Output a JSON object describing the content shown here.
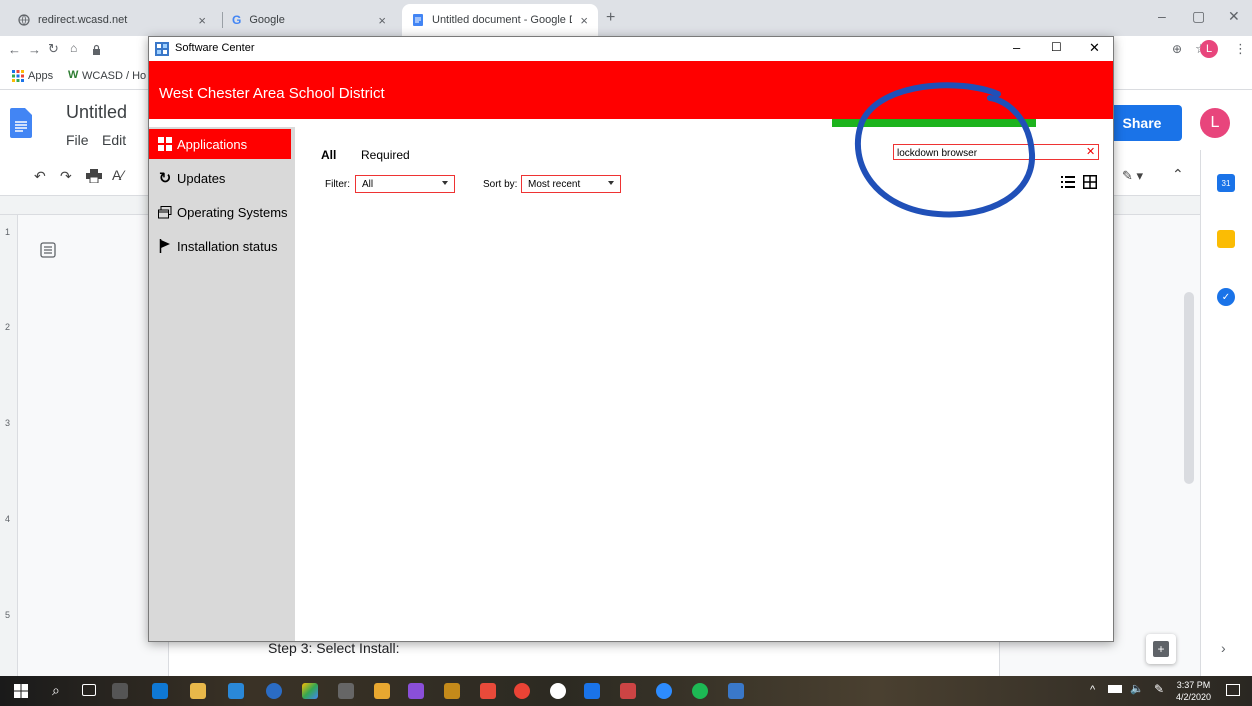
{
  "browser": {
    "tabs": [
      {
        "label": "redirect.wcasd.net",
        "close": "×"
      },
      {
        "label": "Google",
        "close": "×"
      },
      {
        "label": "Untitled document - Google Doc",
        "close": "×"
      }
    ],
    "new_tab": "+",
    "bookmarks": {
      "apps": "Apps",
      "wcasd": "WCASD / Ho"
    },
    "profile_initial": "L"
  },
  "docs": {
    "title": "Untitled",
    "menu_file": "File",
    "menu_edit": "Edit",
    "share_label": "Share",
    "avatar_initial": "L",
    "body_text": "Step 3: Select Install:",
    "ruler_numbers": [
      "1",
      "2",
      "3",
      "4",
      "5"
    ]
  },
  "software_center": {
    "window_title": "Software Center",
    "banner_title": "West Chester Area School District",
    "sidebar": [
      {
        "label": "Applications",
        "icon": "applications-icon",
        "active": true
      },
      {
        "label": "Updates",
        "icon": "refresh-icon",
        "active": false
      },
      {
        "label": "Operating Systems",
        "icon": "windows-stack-icon",
        "active": false
      },
      {
        "label": "Installation status",
        "icon": "flag-icon",
        "active": false
      }
    ],
    "tabs": {
      "all": "All",
      "required": "Required"
    },
    "filter_label": "Filter:",
    "filter_value": "All",
    "sort_label": "Sort by:",
    "sort_value": "Most recent",
    "search_value": "lockdown browser",
    "search_clear": "✕"
  },
  "taskbar": {
    "time": "3:37 PM",
    "date": "4/2/2020"
  },
  "colors": {
    "sc_accent": "#ff0000",
    "sc_progress": "#1db31d",
    "share_blue": "#1a73e8",
    "annotation_circle": "#2050b8",
    "avatar_pink": "#e8457c"
  }
}
